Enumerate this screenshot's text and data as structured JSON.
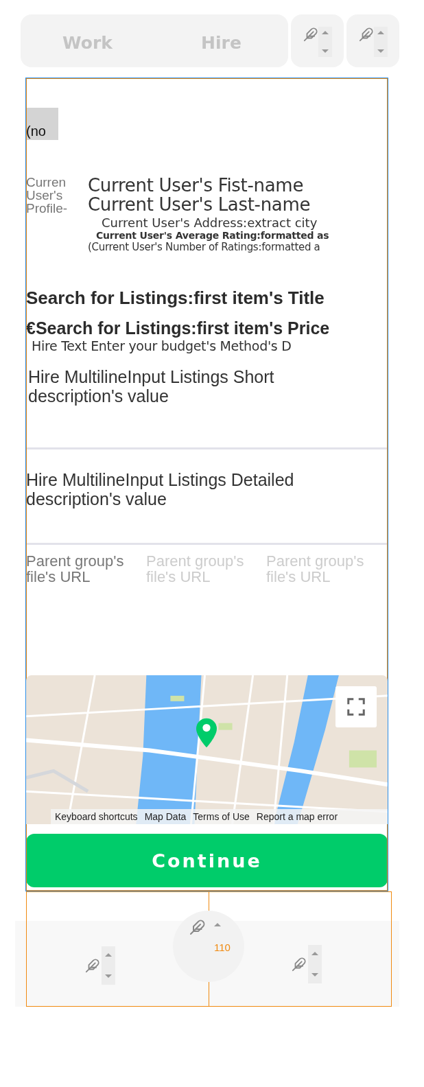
{
  "toggle": {
    "options": [
      {
        "label": "Work"
      },
      {
        "label": "Hire"
      }
    ]
  },
  "image_placeholder": {
    "text": "(no"
  },
  "profile": {
    "picture_alt": "Curren User's Profile-",
    "first_name": "Current User's Fist-name",
    "last_name": "Current User's Last-name",
    "address": "Current User's Address:extract city",
    "rating": "Current User's Average Rating:formatted as",
    "ratings_count": "(Current User's Number of Ratings:formatted a"
  },
  "listing": {
    "title": "Search for Listings:first item's Title",
    "price": "€Search for Listings:first item's Price",
    "budget_method": "Hire Text Enter your budget's Method's D"
  },
  "short_description": {
    "value": "Hire MultilineInput Listings Short description's value"
  },
  "detailed_description": {
    "value": "Hire MultilineInput Listings Detailed description's value"
  },
  "files": [
    {
      "text": "Parent group's file's URL",
      "disabled": false
    },
    {
      "text": "Parent group's file's URL",
      "disabled": true
    },
    {
      "text": "Parent group's file's URL",
      "disabled": true
    }
  ],
  "map": {
    "footer_links": [
      "Keyboard shortcuts",
      "Map Data",
      "Terms of Use",
      "Report a map error"
    ]
  },
  "continue_button": {
    "label": "Continue"
  },
  "footer": {
    "badge": "110"
  }
}
